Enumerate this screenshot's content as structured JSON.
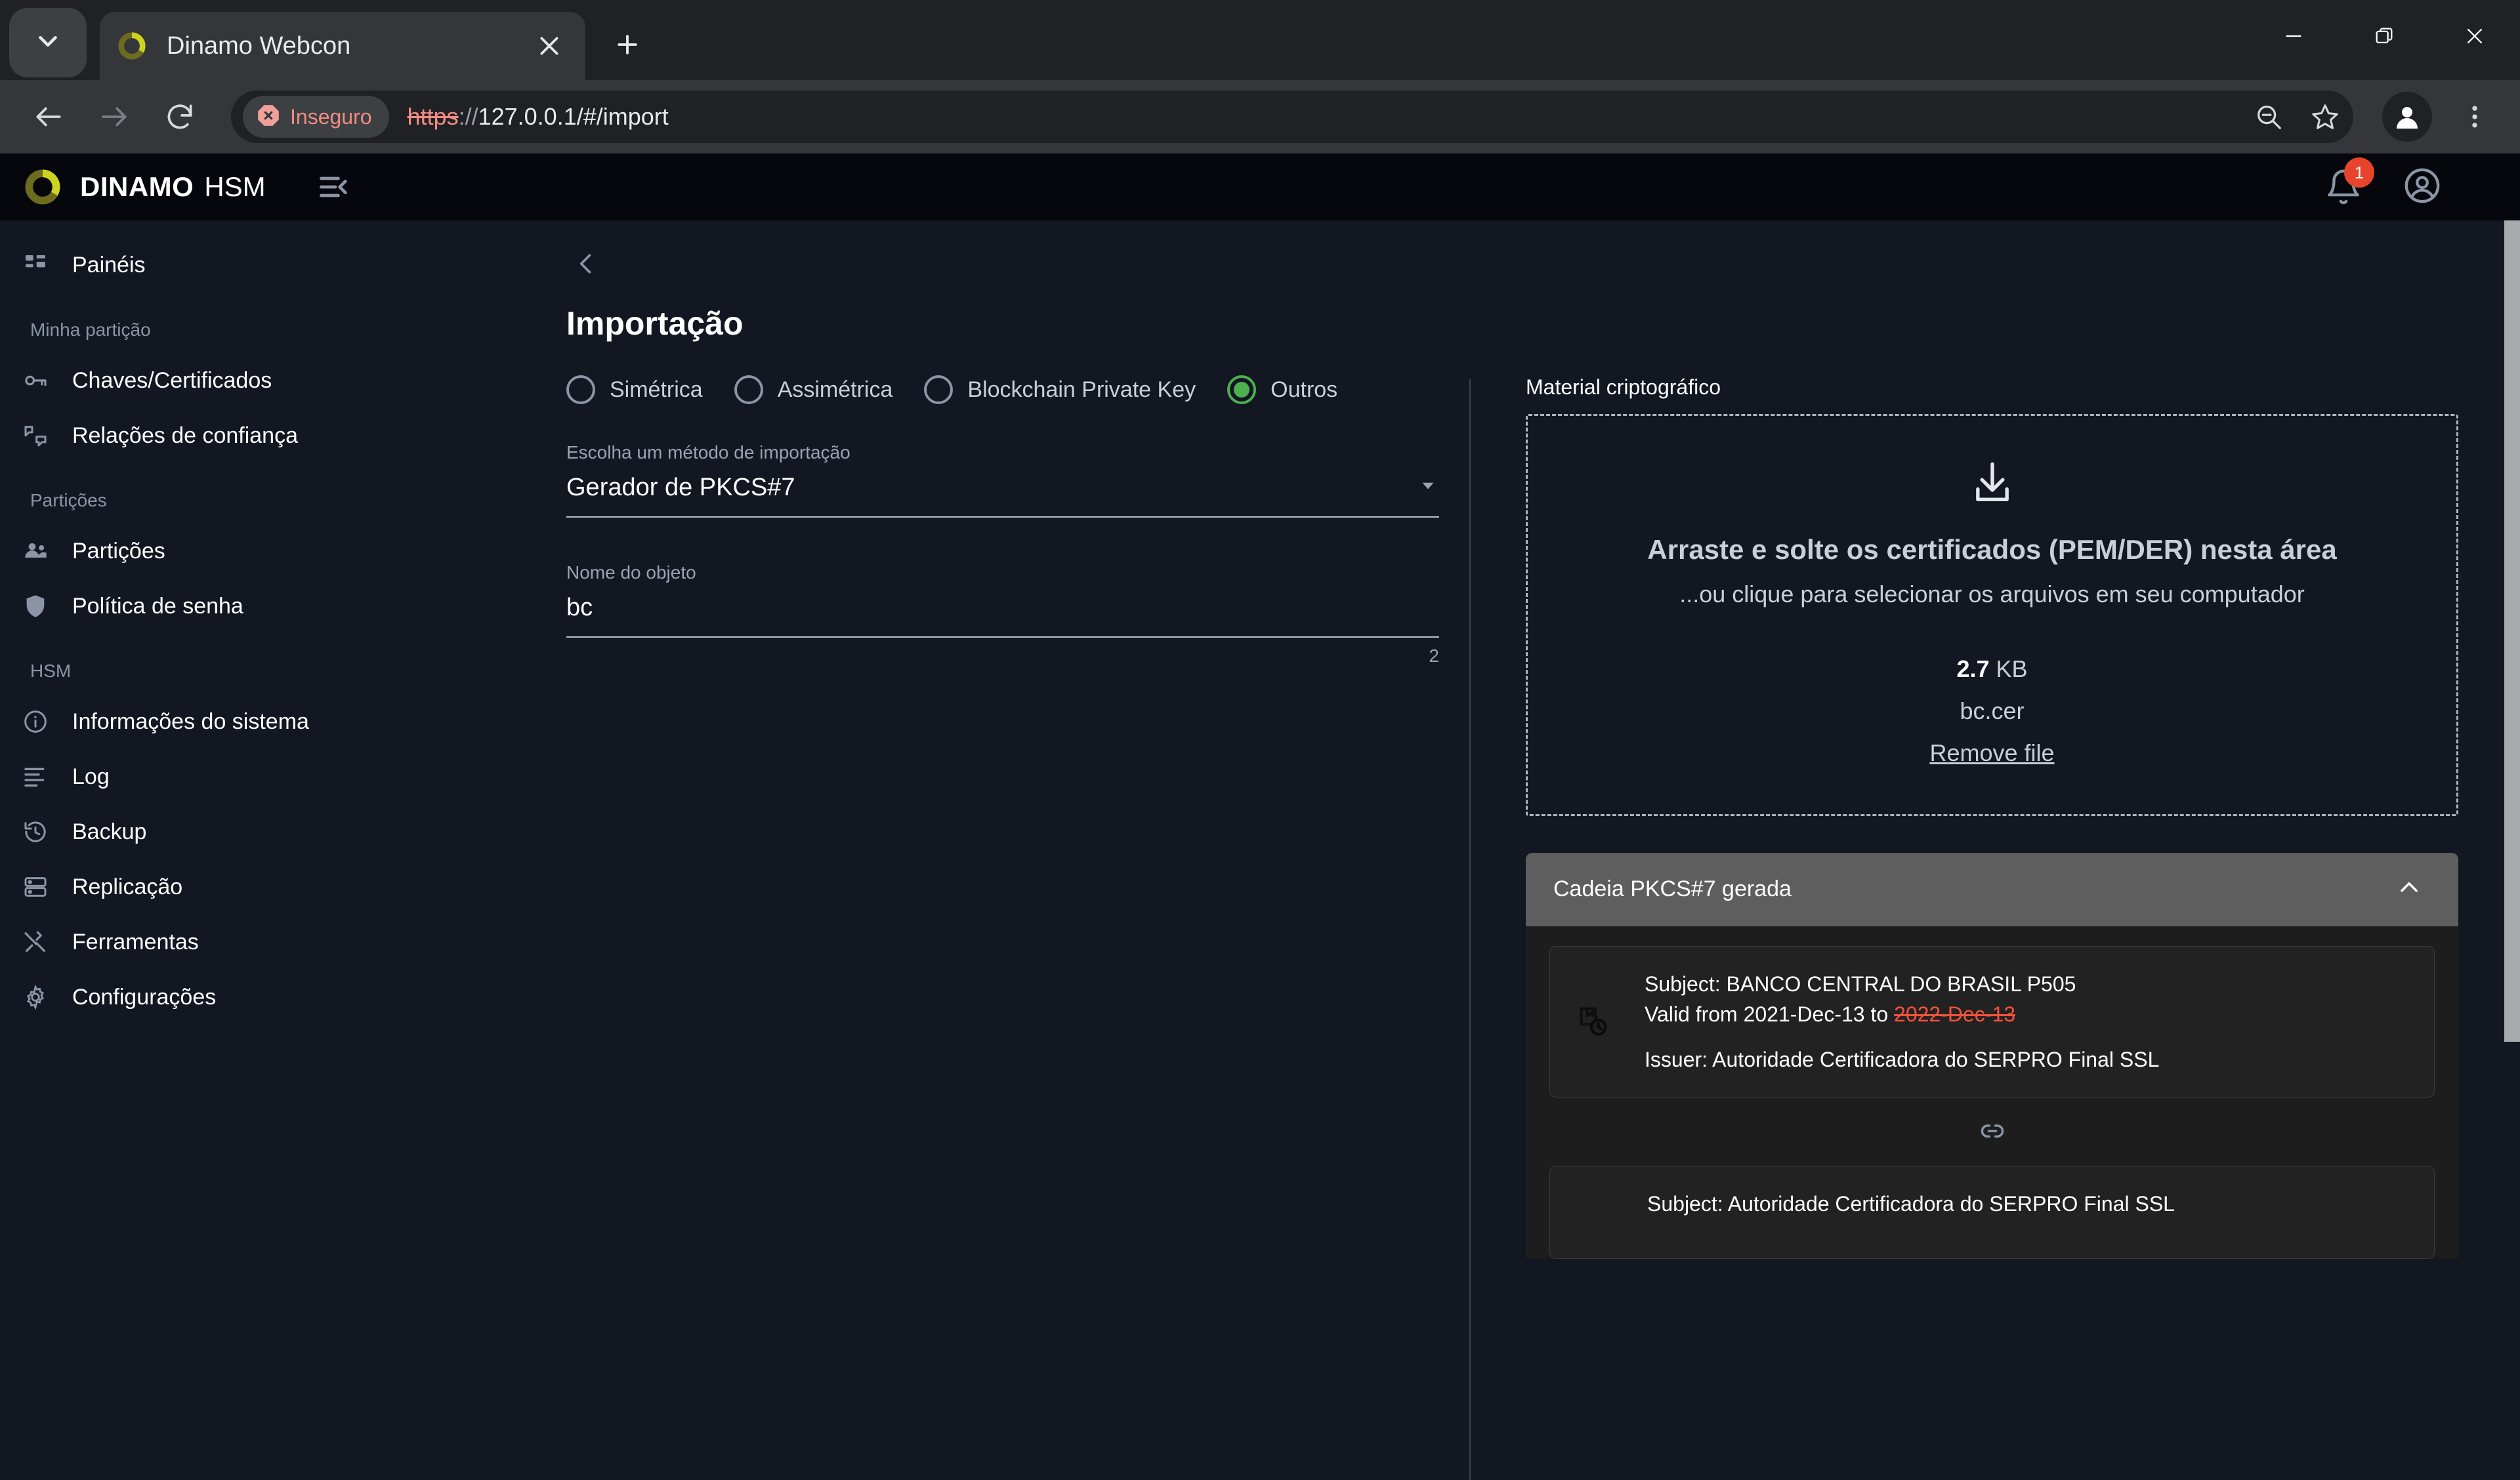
{
  "browser": {
    "tab_search_icon": "chevron-down-icon",
    "tab": {
      "title": "Dinamo Webcon",
      "favicon": "dinamo-ring-icon",
      "close_icon": "close-icon"
    },
    "new_tab_label": "+",
    "window_controls": {
      "minimize": "minimize-icon",
      "maximize": "maximize-icon",
      "close": "close-icon"
    },
    "toolbar": {
      "back_icon": "back-arrow-icon",
      "forward_icon": "forward-arrow-icon",
      "reload_icon": "reload-icon",
      "security_label": "Inseguro",
      "url_scheme": "https",
      "url_separator": "://",
      "url_host_path": "127.0.0.1/#/import",
      "zoom_icon": "zoom-out-icon",
      "bookmark_icon": "star-icon",
      "profile_icon": "profile-avatar-icon",
      "menu_icon": "three-dots-menu-icon"
    }
  },
  "appbar": {
    "brand": "DINAMO",
    "brand_sub": "HSM",
    "collapse_icon": "collapse-sidebar-icon",
    "notifications": {
      "icon": "bell-icon",
      "count": "1"
    },
    "account_icon": "account-circle-icon"
  },
  "sidebar": {
    "items": [
      {
        "type": "item",
        "label": "Painéis",
        "icon": "dashboard-icon"
      },
      {
        "type": "group",
        "label": "Minha partição"
      },
      {
        "type": "item",
        "label": "Chaves/Certificados",
        "icon": "key-icon"
      },
      {
        "type": "item",
        "label": "Relações de confiança",
        "icon": "trust-relations-icon"
      },
      {
        "type": "group",
        "label": "Partições"
      },
      {
        "type": "item",
        "label": "Partições",
        "icon": "people-icon"
      },
      {
        "type": "item",
        "label": "Política de senha",
        "icon": "shield-icon"
      },
      {
        "type": "group",
        "label": "HSM"
      },
      {
        "type": "item",
        "label": "Informações do sistema",
        "icon": "info-icon"
      },
      {
        "type": "item",
        "label": "Log",
        "icon": "log-lines-icon"
      },
      {
        "type": "item",
        "label": "Backup",
        "icon": "history-icon"
      },
      {
        "type": "item",
        "label": "Replicação",
        "icon": "server-stack-icon"
      },
      {
        "type": "item",
        "label": "Ferramentas",
        "icon": "tools-icon"
      },
      {
        "type": "item",
        "label": "Configurações",
        "icon": "gear-icon"
      }
    ]
  },
  "page": {
    "back_icon": "chevron-left-icon",
    "title": "Importação",
    "radios": [
      {
        "label": "Simétrica",
        "selected": false
      },
      {
        "label": "Assimétrica",
        "selected": false
      },
      {
        "label": "Blockchain Private Key",
        "selected": false
      },
      {
        "label": "Outros",
        "selected": true
      }
    ],
    "method_field": {
      "label": "Escolha um método de importação",
      "value": "Gerador de PKCS#7",
      "dropdown_icon": "chevron-down-icon"
    },
    "object_name_field": {
      "label": "Nome do objeto",
      "value": "bc",
      "counter": "2"
    }
  },
  "material": {
    "panel_title": "Material criptográfico",
    "dropzone": {
      "icon": "download-into-tray-icon",
      "title": "Arraste e solte os certificados (PEM/DER) nesta área",
      "subtitle": "...ou clique para selecionar os arquivos em seu computador",
      "file_size_value": "2.7",
      "file_size_unit": "KB",
      "file_name": "bc.cer",
      "remove_label": "Remove file"
    },
    "accordion": {
      "title": "Cadeia PKCS#7 gerada",
      "toggle_icon": "chevron-up-icon",
      "link_icon": "chain-link-icon",
      "certs": [
        {
          "icon": "certificate-clock-icon",
          "subject": "Subject: BANCO CENTRAL DO BRASIL P505",
          "valid_prefix": "Valid from 2021-Dec-13 to ",
          "valid_to_expired": "2022-Dec-13",
          "issuer": "Issuer: Autoridade Certificadora do SERPRO Final SSL"
        },
        {
          "icon": "certificate-clock-icon",
          "subject": "Subject: Autoridade Certificadora do SERPRO Final SSL",
          "valid_prefix": "",
          "valid_to_expired": "",
          "issuer": ""
        }
      ]
    }
  },
  "colors": {
    "app_bg": "#121721",
    "appbar_bg": "#05070c",
    "accent_green": "#4caf50",
    "badge_red": "#e8442d",
    "expired_red": "#f4523b",
    "brand_yellow": "#c8cc2b",
    "insecure_red": "#f28b82"
  }
}
